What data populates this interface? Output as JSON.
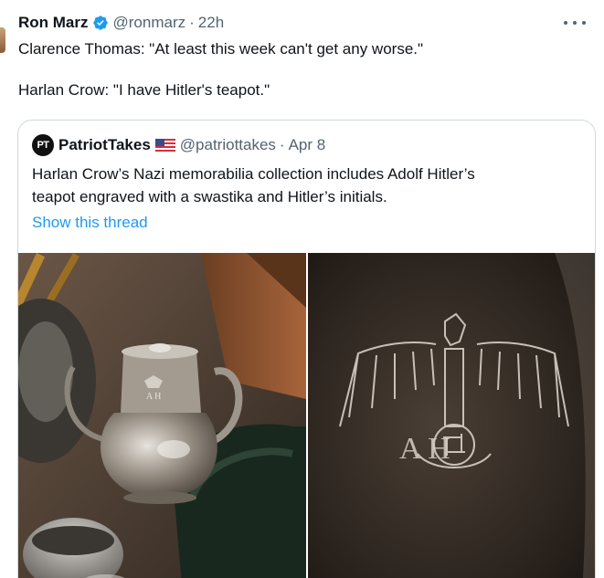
{
  "tweet": {
    "author_name": "Ron Marz",
    "author_handle": "@ronmarz",
    "separator": "·",
    "time": "22h",
    "text_line_1": "Clarence Thomas: \"At least this week can't get any worse.\"",
    "text_line_2": "Harlan Crow: \"I have Hitler's teapot.\"",
    "verified_icon": "verified-badge-icon",
    "more_icon": "more-options-icon"
  },
  "quote": {
    "avatar_text": "PT",
    "author_name": "PatriotTakes",
    "flag_icon": "us-flag-icon",
    "author_handle": "@patriottakes",
    "separator": "·",
    "date": "Apr 8",
    "text_line_1": "Harlan Crow’s Nazi memorabilia collection includes Adolf Hitler’s",
    "text_line_2": "teapot engraved with a swastika and Hitler’s initials.",
    "show_thread": "Show this thread",
    "media": [
      {
        "name": "teapot-photo"
      },
      {
        "name": "engraving-closeup-photo",
        "engraving_text": "A H"
      }
    ]
  },
  "colors": {
    "text_primary": "#0f1419",
    "text_secondary": "#536471",
    "link": "#1d9bf0",
    "border": "#cfd9de",
    "verified": "#1d9bf0"
  }
}
